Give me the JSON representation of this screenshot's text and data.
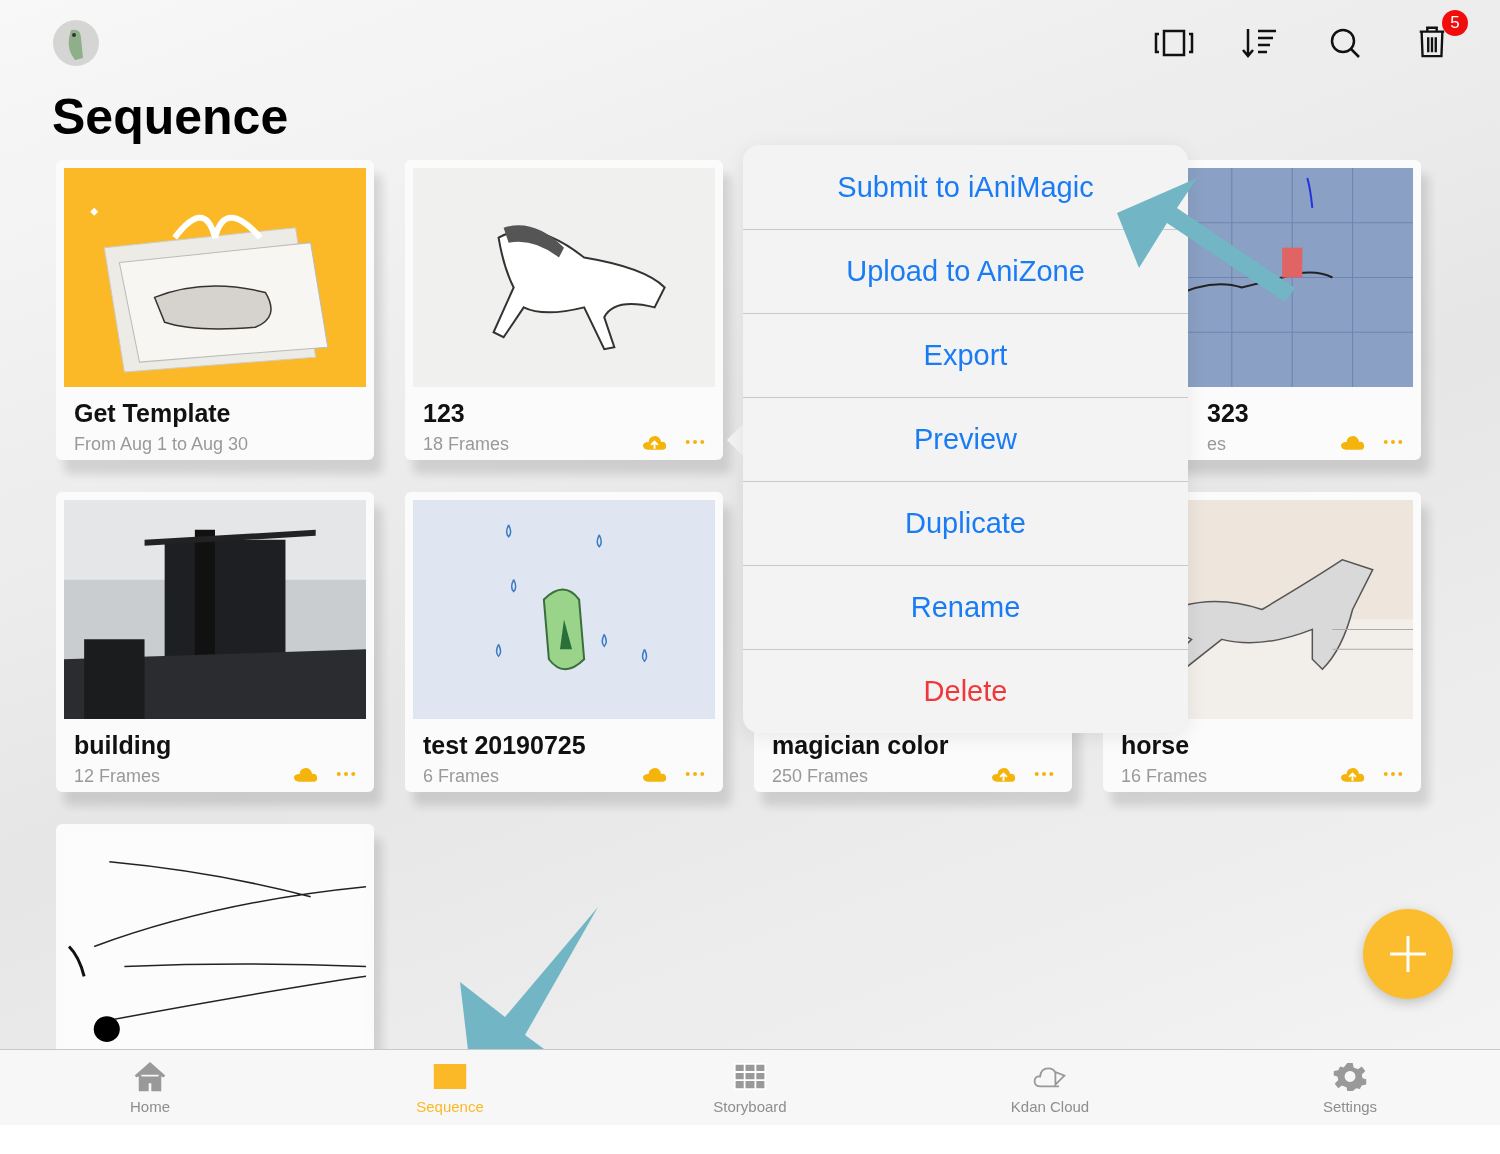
{
  "header": {
    "title": "Sequence",
    "trash_badge": "5"
  },
  "cards": [
    {
      "kind": "template",
      "title": "Get Template",
      "subtitle": "From Aug 1 to Aug 30"
    },
    {
      "kind": "sequence",
      "title": "123",
      "subtitle": "18 Frames",
      "pending_upload": true
    },
    {
      "kind": "sequence",
      "title": "323",
      "subtitle": "es",
      "pending_upload": false,
      "covered": true
    },
    {
      "kind": "sequence",
      "title": "building",
      "subtitle": "12 Frames",
      "pending_upload": false
    },
    {
      "kind": "sequence",
      "title": "test 20190725",
      "subtitle": "6 Frames",
      "pending_upload": false
    },
    {
      "kind": "sequence",
      "title": "magician color",
      "subtitle": "250 Frames",
      "pending_upload": true
    },
    {
      "kind": "sequence",
      "title": "horse",
      "subtitle": "16 Frames",
      "pending_upload": true
    },
    {
      "kind": "sketch"
    }
  ],
  "popover": [
    {
      "label": "Submit to iAniMagic",
      "kind": "default"
    },
    {
      "label": "Upload to AniZone",
      "kind": "default"
    },
    {
      "label": "Export",
      "kind": "default"
    },
    {
      "label": "Preview",
      "kind": "default"
    },
    {
      "label": "Duplicate",
      "kind": "default"
    },
    {
      "label": "Rename",
      "kind": "default"
    },
    {
      "label": "Delete",
      "kind": "destructive"
    }
  ],
  "tabs": [
    {
      "label": "Home",
      "kind": "home",
      "selected": false
    },
    {
      "label": "Sequence",
      "kind": "sequence",
      "selected": true
    },
    {
      "label": "Storyboard",
      "kind": "grid",
      "selected": false
    },
    {
      "label": "Kdan Cloud",
      "kind": "cloud",
      "selected": false
    },
    {
      "label": "Settings",
      "kind": "gear",
      "selected": false
    }
  ]
}
